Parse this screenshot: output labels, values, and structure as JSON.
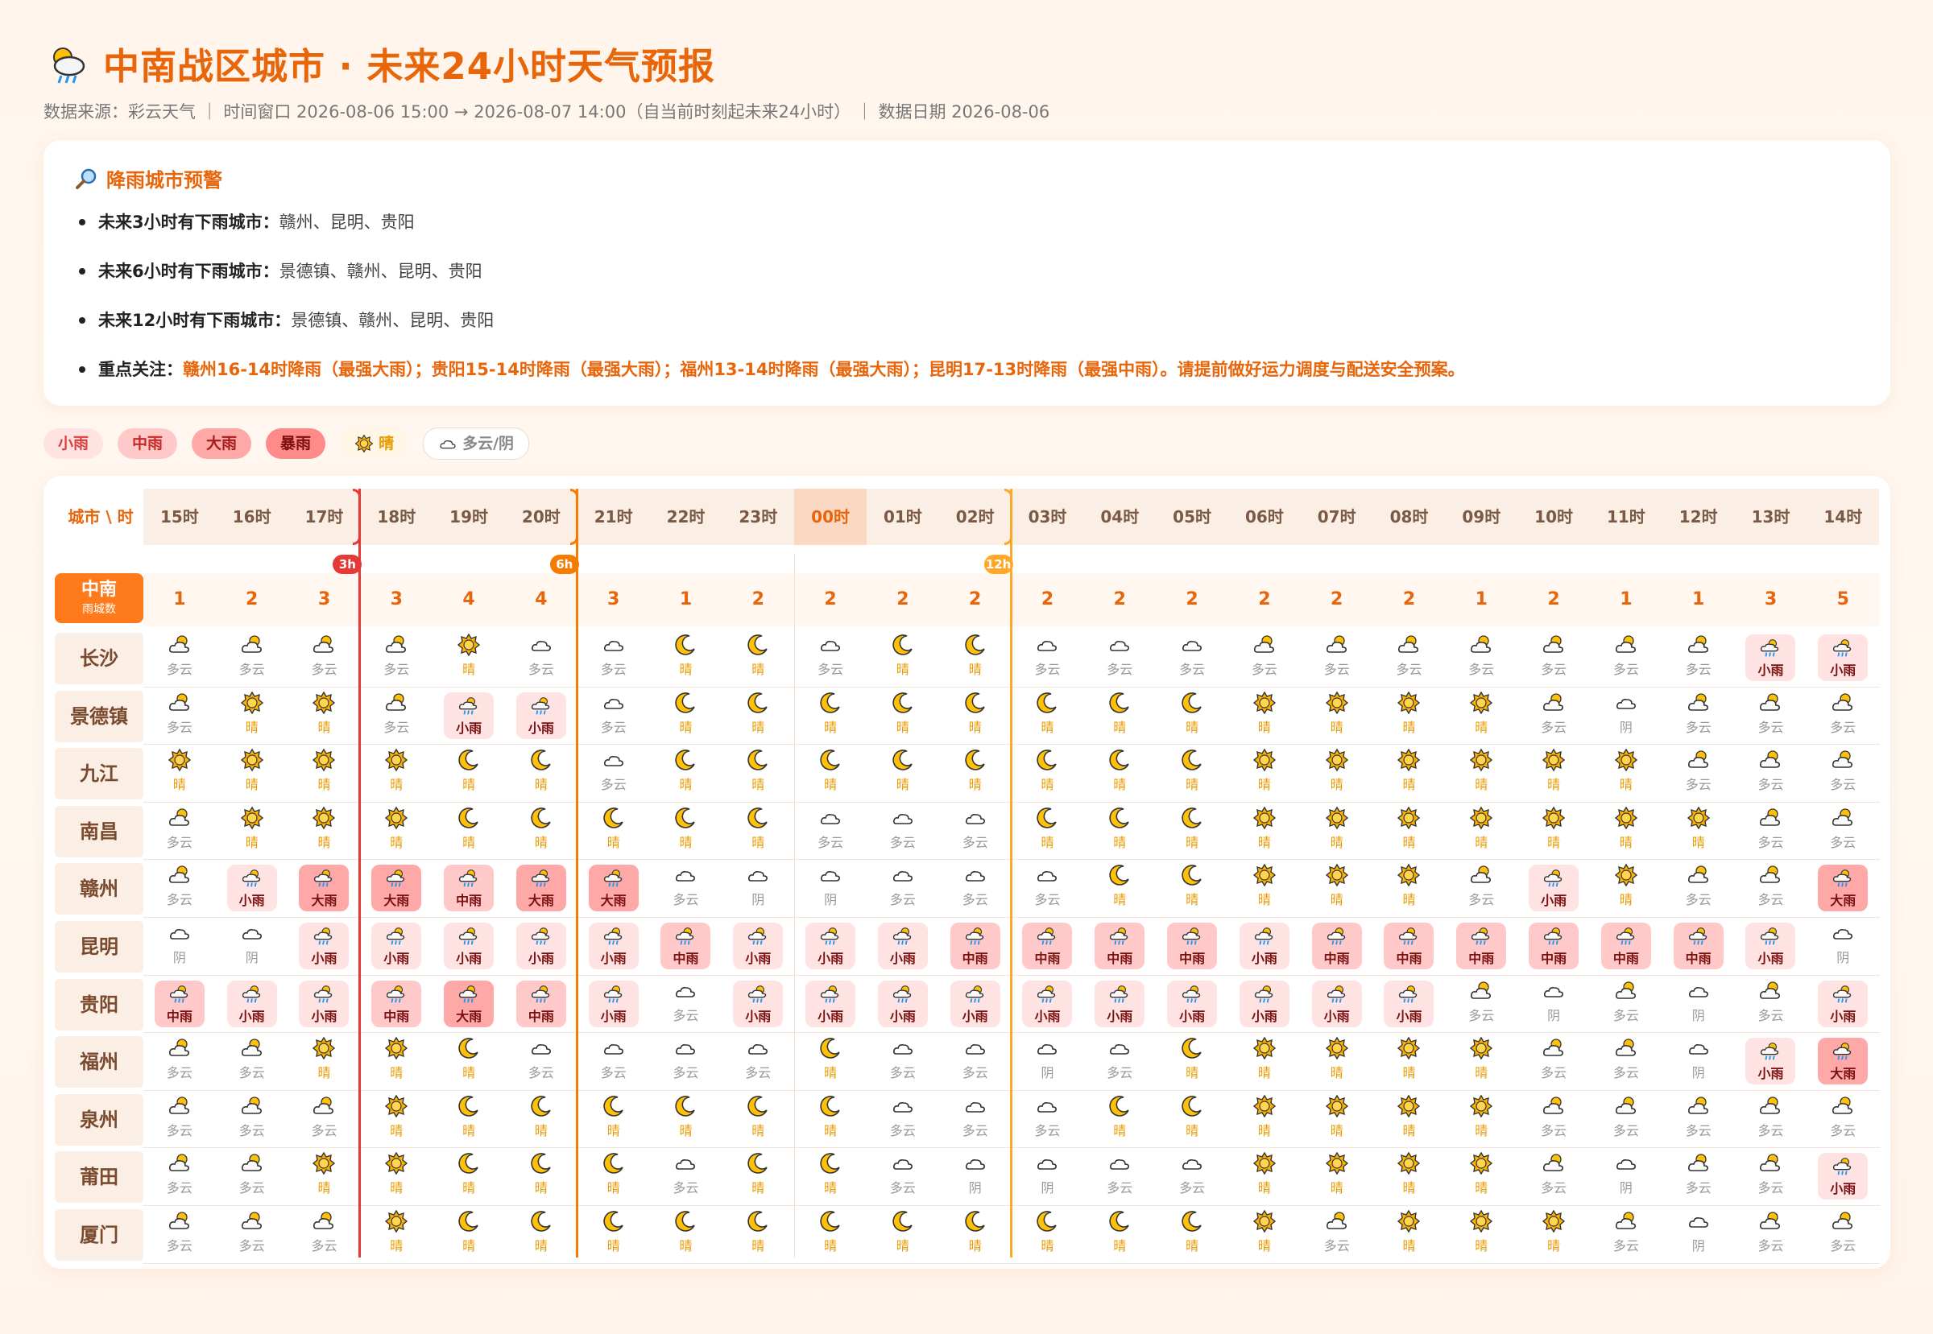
{
  "header": {
    "title": "中南战区城市 · 未来24小时天气预报",
    "subtitle": "数据来源：彩云天气 ｜ 时间窗口 2026-08-06 15:00 → 2026-08-07 14:00（自当前时刻起未来24小时） ｜ 数据日期 2026-08-06"
  },
  "alert": {
    "title": "降雨城市预警",
    "items": [
      {
        "label": "未来3小时有下雨城市：",
        "text": "赣州、昆明、贵阳"
      },
      {
        "label": "未来6小时有下雨城市：",
        "text": "景德镇、赣州、昆明、贵阳"
      },
      {
        "label": "未来12小时有下雨城市：",
        "text": "景德镇、赣州、昆明、贵阳"
      },
      {
        "label": "重点关注：",
        "text": "赣州16-14时降雨（最强大雨）；贵阳15-14时降雨（最强大雨）；福州13-14时降雨（最强大雨）；昆明17-13时降雨（最强中雨）。请提前做好运力调度与配送安全预案。"
      }
    ]
  },
  "legend": [
    {
      "label": "小雨",
      "color": "#ffe3e3",
      "text_color": "#d94040"
    },
    {
      "label": "中雨",
      "color": "#ffc9c9",
      "text_color": "#c62828"
    },
    {
      "label": "大雨",
      "color": "#ffa8a8",
      "text_color": "#a61b1b"
    },
    {
      "label": "暴雨",
      "color": "#ff8a8a",
      "text_color": "#7a0d0d"
    },
    {
      "label": "晴",
      "color": "#fff7e6",
      "text_color": "#e89a00",
      "icon": "sun-icon"
    },
    {
      "label": "多云/阴",
      "color": "#ffffff",
      "text_color": "#888888",
      "icon": "cloud-icon"
    }
  ],
  "grid": {
    "corner": "城市 \\ 时",
    "hours": [
      "15时",
      "16时",
      "17时",
      "18时",
      "19时",
      "20时",
      "21时",
      "22时",
      "23时",
      "00时",
      "01时",
      "02时",
      "03时",
      "04时",
      "05时",
      "06时",
      "07时",
      "08时",
      "09时",
      "10时",
      "11时",
      "12时",
      "13时",
      "14时"
    ],
    "now_index": 9,
    "markers": [
      {
        "after_index": 2,
        "label": "3h",
        "color": "#e53935"
      },
      {
        "after_index": 5,
        "label": "6h",
        "color": "#f57c00"
      },
      {
        "after_index": 11,
        "label": "12h",
        "color": "#ffa726"
      }
    ],
    "count_label": "中南",
    "count_sublabel": "雨城数",
    "counts": [
      "1",
      "2",
      "3",
      "3",
      "4",
      "4",
      "3",
      "1",
      "2",
      "2",
      "2",
      "2",
      "2",
      "2",
      "2",
      "2",
      "2",
      "2",
      "1",
      "2",
      "1",
      "1",
      "3",
      "5"
    ],
    "cities": [
      {
        "name": "长沙",
        "cells": [
          "C",
          "C",
          "C",
          "C",
          "S",
          "O",
          "O",
          "M",
          "M",
          "O",
          "M",
          "M",
          "O",
          "O",
          "O",
          "C",
          "C",
          "C",
          "C",
          "C",
          "C",
          "C",
          "r1",
          "r1"
        ]
      },
      {
        "name": "景德镇",
        "cells": [
          "C",
          "S",
          "S",
          "C",
          "r1",
          "r1",
          "O",
          "M",
          "M",
          "M",
          "M",
          "M",
          "M",
          "M",
          "M",
          "S",
          "S",
          "S",
          "S",
          "C",
          "Y",
          "C",
          "C",
          "C"
        ]
      },
      {
        "name": "九江",
        "cells": [
          "S",
          "S",
          "S",
          "S",
          "M",
          "M",
          "O",
          "M",
          "M",
          "M",
          "M",
          "M",
          "M",
          "M",
          "M",
          "S",
          "S",
          "S",
          "S",
          "S",
          "S",
          "C",
          "C",
          "C"
        ]
      },
      {
        "name": "南昌",
        "cells": [
          "C",
          "S",
          "S",
          "S",
          "M",
          "M",
          "M",
          "M",
          "M",
          "O",
          "O",
          "O",
          "M",
          "M",
          "M",
          "S",
          "S",
          "S",
          "S",
          "S",
          "S",
          "S",
          "C",
          "C"
        ]
      },
      {
        "name": "赣州",
        "cells": [
          "C",
          "r1",
          "r3",
          "r3",
          "r2",
          "r3",
          "r3",
          "O",
          "Y",
          "Y",
          "O",
          "O",
          "O",
          "M",
          "M",
          "S",
          "S",
          "S",
          "C",
          "r1",
          "S",
          "C",
          "C",
          "r3"
        ]
      },
      {
        "name": "昆明",
        "cells": [
          "Y",
          "Y",
          "r1",
          "r1",
          "r1",
          "r1",
          "r1",
          "r2",
          "r1",
          "r1",
          "r1",
          "r2",
          "r2",
          "r2",
          "r2",
          "r1",
          "r2",
          "r2",
          "r2",
          "r2",
          "r2",
          "r2",
          "r1",
          "Y"
        ]
      },
      {
        "name": "贵阳",
        "cells": [
          "r2",
          "r1",
          "r1",
          "r2",
          "r3",
          "r2",
          "r1",
          "O",
          "r1",
          "r1",
          "r1",
          "r1",
          "r1",
          "r1",
          "r1",
          "r1",
          "r1",
          "r1",
          "C",
          "Y",
          "C",
          "Y",
          "C",
          "r1"
        ]
      },
      {
        "name": "福州",
        "cells": [
          "C",
          "C",
          "S",
          "S",
          "M",
          "O",
          "O",
          "O",
          "O",
          "M",
          "O",
          "O",
          "Y",
          "O",
          "M",
          "S",
          "S",
          "S",
          "S",
          "C",
          "C",
          "Y",
          "r1",
          "r3"
        ]
      },
      {
        "name": "泉州",
        "cells": [
          "C",
          "C",
          "C",
          "S",
          "M",
          "M",
          "M",
          "M",
          "M",
          "M",
          "O",
          "O",
          "O",
          "M",
          "M",
          "S",
          "S",
          "S",
          "S",
          "C",
          "C",
          "C",
          "C",
          "C"
        ]
      },
      {
        "name": "莆田",
        "cells": [
          "C",
          "C",
          "S",
          "S",
          "M",
          "M",
          "M",
          "O",
          "M",
          "M",
          "O",
          "Y",
          "Y",
          "O",
          "O",
          "S",
          "S",
          "S",
          "S",
          "C",
          "Y",
          "C",
          "C",
          "r1"
        ]
      },
      {
        "name": "厦门",
        "cells": [
          "C",
          "C",
          "C",
          "S",
          "M",
          "M",
          "M",
          "M",
          "M",
          "M",
          "M",
          "M",
          "M",
          "M",
          "M",
          "S",
          "C",
          "S",
          "S",
          "S",
          "C",
          "Y",
          "C",
          "C"
        ]
      }
    ],
    "labels": {
      "S": "晴",
      "M": "晴",
      "C": "多云",
      "O": "多云",
      "Y": "阴",
      "r1": "小雨",
      "r2": "中雨",
      "r3": "大雨",
      "r4": "暴雨"
    }
  }
}
